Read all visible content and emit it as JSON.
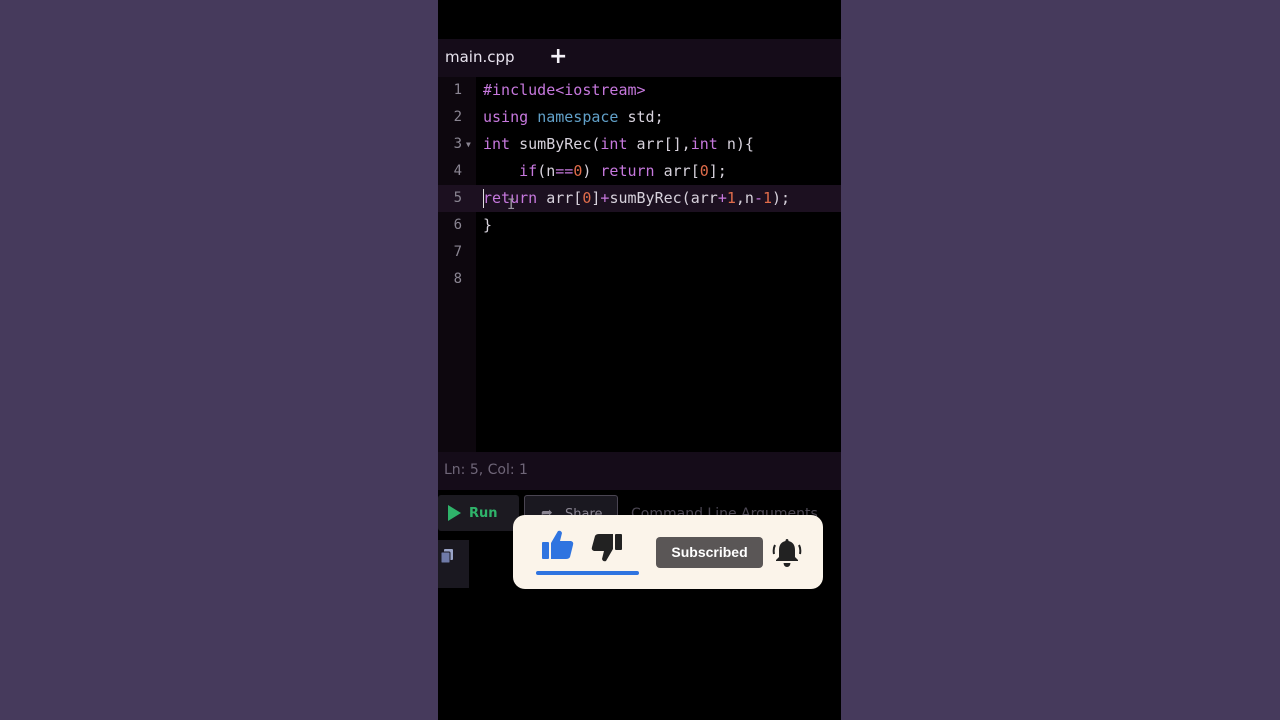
{
  "editor": {
    "tab": {
      "filename": "main.cpp",
      "add_symbol": "+"
    },
    "lines": [
      {
        "number": "1"
      },
      {
        "number": "2"
      },
      {
        "number": "3"
      },
      {
        "number": "4"
      },
      {
        "number": "5"
      },
      {
        "number": "6"
      },
      {
        "number": "7"
      },
      {
        "number": "8"
      }
    ],
    "code": {
      "l1": "#include<iostream>",
      "l2_kw": "using",
      "l2_ns": "namespace",
      "l2_rest": " std;",
      "l3_t1": "int",
      "l3_a": " sumByRec(",
      "l3_t2": "int",
      "l3_b": " arr[],",
      "l3_t3": "int",
      "l3_c": " n){",
      "l4_indent": "    ",
      "l4_if": "if",
      "l4_a": "(n",
      "l4_op": "==",
      "l4_n0": "0",
      "l4_b": ") ",
      "l4_ret": "return",
      "l4_c": " arr[",
      "l4_n1": "0",
      "l4_d": "];",
      "l5_ret": "return",
      "l5_a": " arr[",
      "l5_n0": "0",
      "l5_b": "]",
      "l5_op1": "+",
      "l5_c": "sumByRec(arr",
      "l5_op2": "+",
      "l5_n1": "1",
      "l5_d": ",n",
      "l5_op3": "-",
      "l5_n2": "1",
      "l5_e": ");",
      "l6": "}"
    },
    "active_line": 5,
    "status": "Ln: 5,  Col: 1"
  },
  "toolbar": {
    "run_label": "Run",
    "share_label": "Share",
    "command_line_label": "Command Line Arguments"
  },
  "overlay": {
    "subscribed_label": "Subscribed"
  },
  "colors": {
    "keyword": "#c678dd",
    "namespace": "#61a0c8",
    "number": "#e06c4a",
    "run": "#2fb36a",
    "like": "#2f74e0"
  }
}
